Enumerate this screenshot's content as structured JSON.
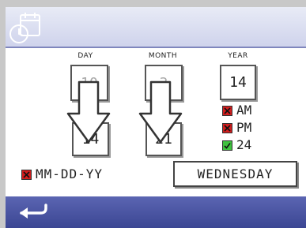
{
  "labels": {
    "day": "DAY",
    "month": "MONTH",
    "year": "YEAR"
  },
  "day": {
    "previous": "10",
    "new": "14"
  },
  "month": {
    "previous": "3",
    "new": "21"
  },
  "year": {
    "value": "14"
  },
  "options": {
    "am": {
      "label": "AM",
      "checked": false
    },
    "pm": {
      "label": "PM",
      "checked": false
    },
    "h24": {
      "label": "24",
      "checked": true
    }
  },
  "date_format": {
    "label": "MM-DD-YY",
    "checked": false
  },
  "weekday": "WEDNESDAY",
  "colors": {
    "header": "#cfd3ec",
    "footer": "#3b4693",
    "checkbox_off": "#d21d1d",
    "checkbox_on": "#3fc23f"
  },
  "icons": {
    "header": "calendar-clock-icon",
    "back": "back-arrow-icon",
    "arrows": "down-arrow-icon"
  }
}
